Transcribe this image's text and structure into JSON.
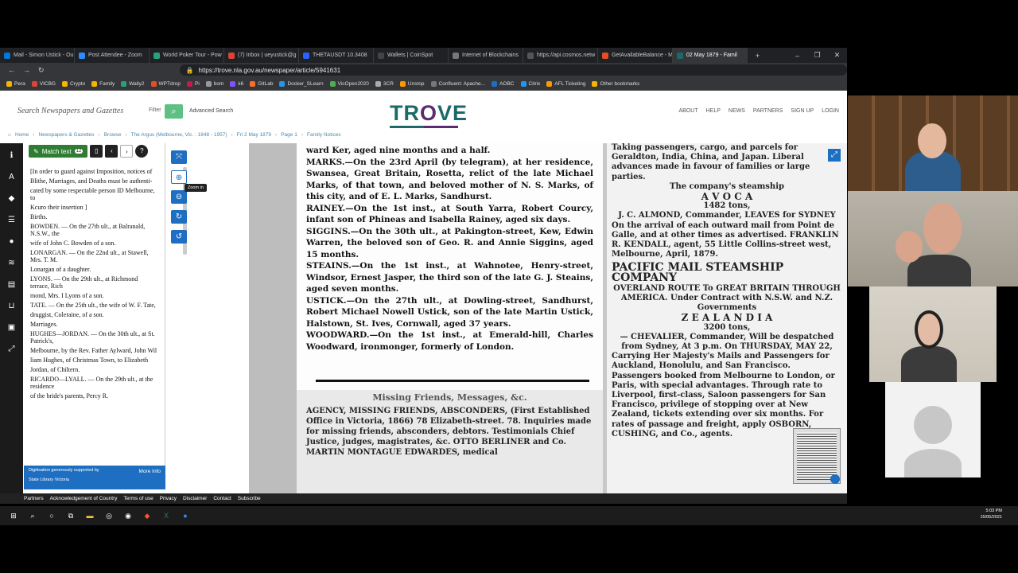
{
  "browser": {
    "tabs": [
      {
        "label": "Mail - Simon Ustick - Ou",
        "color": "#0078d4"
      },
      {
        "label": "Post Attendee - Zoom",
        "color": "#2d8cff"
      },
      {
        "label": "World Poker Tour - Pow",
        "color": "#26a17b"
      },
      {
        "label": "(7) Inbox | ueyustick@g",
        "color": "#db4437"
      },
      {
        "label": "THETAUSDT 10.3408",
        "color": "#2962ff"
      },
      {
        "label": "Wallets | CoinSpot",
        "color": "#444"
      },
      {
        "label": "Internet of Blockchains",
        "color": "#777"
      },
      {
        "label": "https://api.cosmos.netw",
        "color": "#555"
      },
      {
        "label": "GetAvailableBalance - M",
        "color": "#e44d26"
      },
      {
        "label": "02 May 1879 - Famil",
        "color": "#1a6b68"
      }
    ],
    "url": "https://trove.nla.gov.au/newspaper/article/5941631",
    "bookmarks": [
      "Pera",
      "VICBG",
      "Crypto",
      "Family",
      "Wally2",
      "WPTdrop",
      "Pi",
      "bom",
      "k6",
      "GitLab",
      "Docker_SLearn",
      "VicOpen2020",
      "3CR",
      "Unstop",
      "Confluent: Apache...",
      "AOBC",
      "Citrix",
      "AFL Ticketing",
      "Other bookmarks"
    ]
  },
  "header": {
    "search_placeholder": "Search Newspapers and Gazettes",
    "filter": "Filter",
    "advanced": "Advanced Search",
    "logo_a": "TR",
    "logo_o": "O",
    "logo_b": "VE",
    "nav": [
      "ABOUT",
      "HELP",
      "NEWS",
      "PARTNERS",
      "SIGN UP",
      "LOGIN"
    ]
  },
  "breadcrumbs": [
    "Home",
    "Newspapers & Gazettes",
    "Browse",
    "The Argus (Melbourne, Vic. : 1848 - 1957)",
    "Fri 2 May 1879",
    "Page 1",
    "Family Notices"
  ],
  "panel": {
    "match_text": "Match text",
    "count": "12",
    "ocr": [
      "[In order to guard against Imposition, notices of",
      "Blithe, Marriages, and Deaths must be authenti-",
      "cated by some respectable person ID Melbourne, to",
      "Kcuro their insertion ]",
      "Births.",
      "BOWDEN. — On the 27th ult., at Balranald, N.S.W., the",
      "wife of John C. Bowden of a son.",
      "LONARGAN. — On the 22nd ult., at Stawell, Mrs. T. M.",
      "Lonargan of a daughter.",
      "LYONS. — On the 29th ult., at Richmond terrace, Rich",
      "mond, Mrs. I Lyons of a son.",
      "TATE. — On the 25th ult., the wife of W. F. Tate,",
      "druggist, Coleraine, of a son.",
      "Marriages.",
      "HUGHES—JORDAN. — On the 30th ult., at St. Patrick's,",
      "Melbourne, by the Rev. Father Aylward, John Wil",
      "liam Hughes, of Christmas Town, to Elizabeth",
      "Jordan, of Chiltern.",
      "RICARDO—LYALL. — On the 29th ult., at the residence",
      "of the bride's parents, Percy R."
    ],
    "credit": "Digitisation generously supported by",
    "credit_org": "State Library Victoria",
    "more_info": "More Info"
  },
  "viewer": {
    "tooltip": "Zoom in",
    "notices": [
      "ward Ker, aged nine months and a half.",
      "MARKS.—On the 23rd April (by telegram), at her residence, Swansea, Great Britain, Rosetta, relict of the late Michael Marks, of that town, and beloved mother of N. S. Marks, of this city, and of E. L. Marks, Sandhurst.",
      "RAINEY.—On the 1st inst., at South Yarra, Robert Courcy, infant son of Phineas and Isabella Rainey, aged six days.",
      "SIGGINS.—On the 30th ult., at Pakington-street, Kew, Edwin Warren, the beloved son of Geo. R. and Annie Siggins, aged 15 months.",
      "STEAINS.—On the 1st inst., at Wahnotee, Henry-street, Windsor, Ernest Jasper, the third son of the late G. J. Steains, aged seven months.",
      "USTICK.—On the 27th ult., at Dowling-street, Sandhurst, Robert Michael Nowell Ustick, son of the late Martin Ustick, Halstown, St. Ives, Cornwall, aged 37 years.",
      "WOODWARD.—On the 1st inst., at Emerald-hill, Charles Woodward, ironmonger, formerly of London."
    ],
    "missing_head": "Missing Friends, Messages, &c.",
    "missing_text": "AGENCY, MISSING FRIENDS, ABSCONDERS, (First Established Office in Victoria, 1866) 78 Elizabeth-street. 78. Inquiries made for missing friends, absconders, debtors. Testimonials Chief Justice, judges, magistrates, &c. OTTO BERLINER and Co.",
    "martin": "MARTIN MONTAGUE EDWARDES, medical",
    "col4_top": "Taking passengers, cargo, and parcels for Geraldton, India, China, and Japan. Liberal advances made in favour of families or large parties.",
    "col4_co": "The company's steamship",
    "col4_ship": "A V O C A",
    "col4_tons": "1482 tons,",
    "col4_cmd": "J. C. ALMOND, Commander, LEAVES for SYDNEY",
    "col4_text": "On the arrival of each outward mail from Point de Galle, and at other times as advertised. FRANKLIN R. KENDALL, agent, 55 Little Collins-street west, Melbourne, April, 1879.",
    "col4_pacific": "PACIFIC MAIL STEAMSHIP COMPANY",
    "col4_overland": "OVERLAND ROUTE To GREAT BRITAIN THROUGH AMERICA. Under Contract with N.S.W. and N.Z. Governments",
    "col4_zeal": "Z E A L A N D I A",
    "col4_zt": "3200 tons,",
    "col4_chev": "— CHEVALIER, Commander, Will be despatched from Sydney, At 3 p.m. On THURSDAY, MAY 22,",
    "col4_rest": "Carrying Her Majesty's Mails and Passengers for Auckland, Honolulu, and San Francisco. Passengers booked from Melbourne to London, or Paris, with special advantages. Through rate to Liverpool, first-class, Saloon passengers for San Francisco, privilege of stopping over at New Zealand, tickets extending over six months. For rates of passage and freight, apply OSBORN, CUSHING, and Co., agents."
  },
  "footer": [
    "Partners",
    "Acknowledgement of Country",
    "Terms of use",
    "Privacy",
    "Disclaimer",
    "Contact",
    "Subscribe"
  ],
  "clock": {
    "time": "5:03 PM",
    "date": "15/05/2021"
  }
}
